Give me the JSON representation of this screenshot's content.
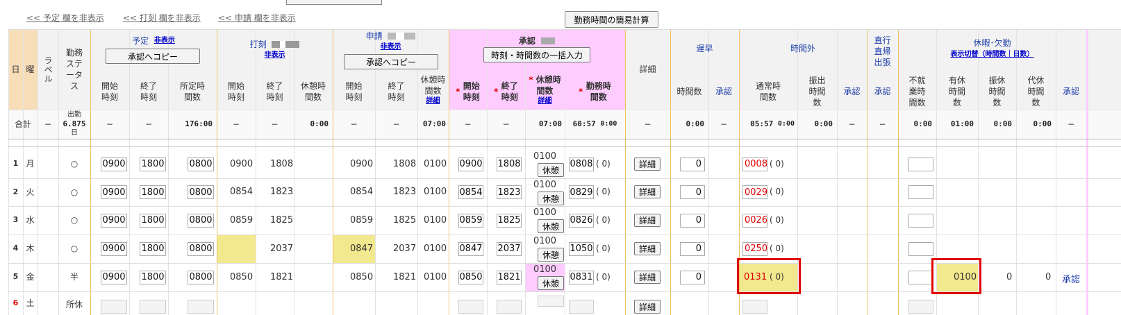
{
  "top": {
    "hide_schedule": "<< 予定 欄を非表示",
    "hide_stamp": "<< 打刻 欄を非表示",
    "hide_request": "<< 申請 欄を非表示",
    "calc_button": "勤務時間の簡易計算"
  },
  "header": {
    "day": "日",
    "weekday": "曜",
    "label": "ラベル",
    "status": "勤務ステータス",
    "schedule": "予定",
    "hide": "非表示",
    "copy_to_approval": "承認へコピー",
    "stamp": "打刻",
    "request": "申請",
    "approval": "承認",
    "bulk_input": "時刻・時間数の一括入力",
    "detail": "詳細",
    "early_late": "遅早",
    "overtime": "時間外",
    "direct": "直行直帰出張",
    "leave": "休暇･欠勤",
    "display_toggle": "表示切替（時間数｜日数）",
    "start_time": "開始時刻",
    "end_time": "終了時刻",
    "scheduled_hours": "所定時間数",
    "break_hours": "休憩時間数",
    "detail_link": "詳細",
    "req_start": "開始時刻",
    "req_end": "終了時刻",
    "req_break": "休憩時間数",
    "req_work": "勤務時間数",
    "hours": "時間数",
    "approve": "承認",
    "normal_hours": "通常時間数",
    "transfer_hours": "振出時間数",
    "absence_hours": "不就業時間数",
    "paid_leave": "有休時間数",
    "comp_day": "振休時間数",
    "sub_day": "代休時間数"
  },
  "totals": {
    "label": "合計",
    "dash": "−",
    "status_top": "出勤",
    "status_val": "6.875",
    "status_unit": "日",
    "scheduled": "176:00",
    "stamp_break": "0:00",
    "request_break": "07:00",
    "approval_break": "07:00",
    "work_main": "60:57",
    "work_sub": "0:00",
    "early_hours": "0:00",
    "ot_normal": "05:57",
    "ot_normal_sub": "0:00",
    "ot_transfer": "0:00",
    "absence": "0:00",
    "paid": "01:00",
    "comp": "0:00",
    "sub": "0:00"
  },
  "rows": [
    {
      "day": "1",
      "wd": "月",
      "status": "○",
      "s_start": "0900",
      "s_end": "1800",
      "s_hours": "0800",
      "p_start": "0900",
      "p_end": "1808",
      "r_start": "0900",
      "r_end": "1808",
      "r_break": "0100",
      "a_start": "0900",
      "a_end": "1808",
      "a_break": "0100",
      "a_work": "0808",
      "early": "0",
      "ot": "0008"
    },
    {
      "day": "2",
      "wd": "火",
      "status": "○",
      "s_start": "0900",
      "s_end": "1800",
      "s_hours": "0800",
      "p_start": "0854",
      "p_end": "1823",
      "r_start": "0854",
      "r_end": "1823",
      "r_break": "0100",
      "a_start": "0854",
      "a_end": "1823",
      "a_break": "0100",
      "a_work": "0829",
      "early": "0",
      "ot": "0029"
    },
    {
      "day": "3",
      "wd": "水",
      "status": "○",
      "s_start": "0900",
      "s_end": "1800",
      "s_hours": "0800",
      "p_start": "0859",
      "p_end": "1825",
      "r_start": "0859",
      "r_end": "1825",
      "r_break": "0100",
      "a_start": "0859",
      "a_end": "1825",
      "a_break": "0100",
      "a_work": "0826",
      "early": "0",
      "ot": "0026"
    },
    {
      "day": "4",
      "wd": "木",
      "status": "○",
      "s_start": "0900",
      "s_end": "1800",
      "s_hours": "0800",
      "p_start": "",
      "p_end": "2037",
      "r_start": "0847",
      "r_end": "2037",
      "r_break": "0100",
      "a_start": "0847",
      "a_end": "2037",
      "a_break": "0100",
      "a_work": "1050",
      "early": "0",
      "ot": "0250"
    },
    {
      "day": "5",
      "wd": "金",
      "status": "半",
      "s_start": "0900",
      "s_end": "1800",
      "s_hours": "0800",
      "p_start": "0850",
      "p_end": "1821",
      "r_start": "0850",
      "r_end": "1821",
      "r_break": "0100",
      "a_start": "0850",
      "a_end": "1821",
      "a_break": "0100",
      "a_work": "0831",
      "early": "0",
      "ot": "0131",
      "paid": "0100",
      "comp": "0",
      "sub": "0",
      "approve": "承認"
    }
  ],
  "row6": {
    "day": "6",
    "wd": "土",
    "status": "所休"
  },
  "labels": {
    "break_btn": "休憩",
    "detail_btn": "詳細",
    "paren": "(    0)"
  }
}
